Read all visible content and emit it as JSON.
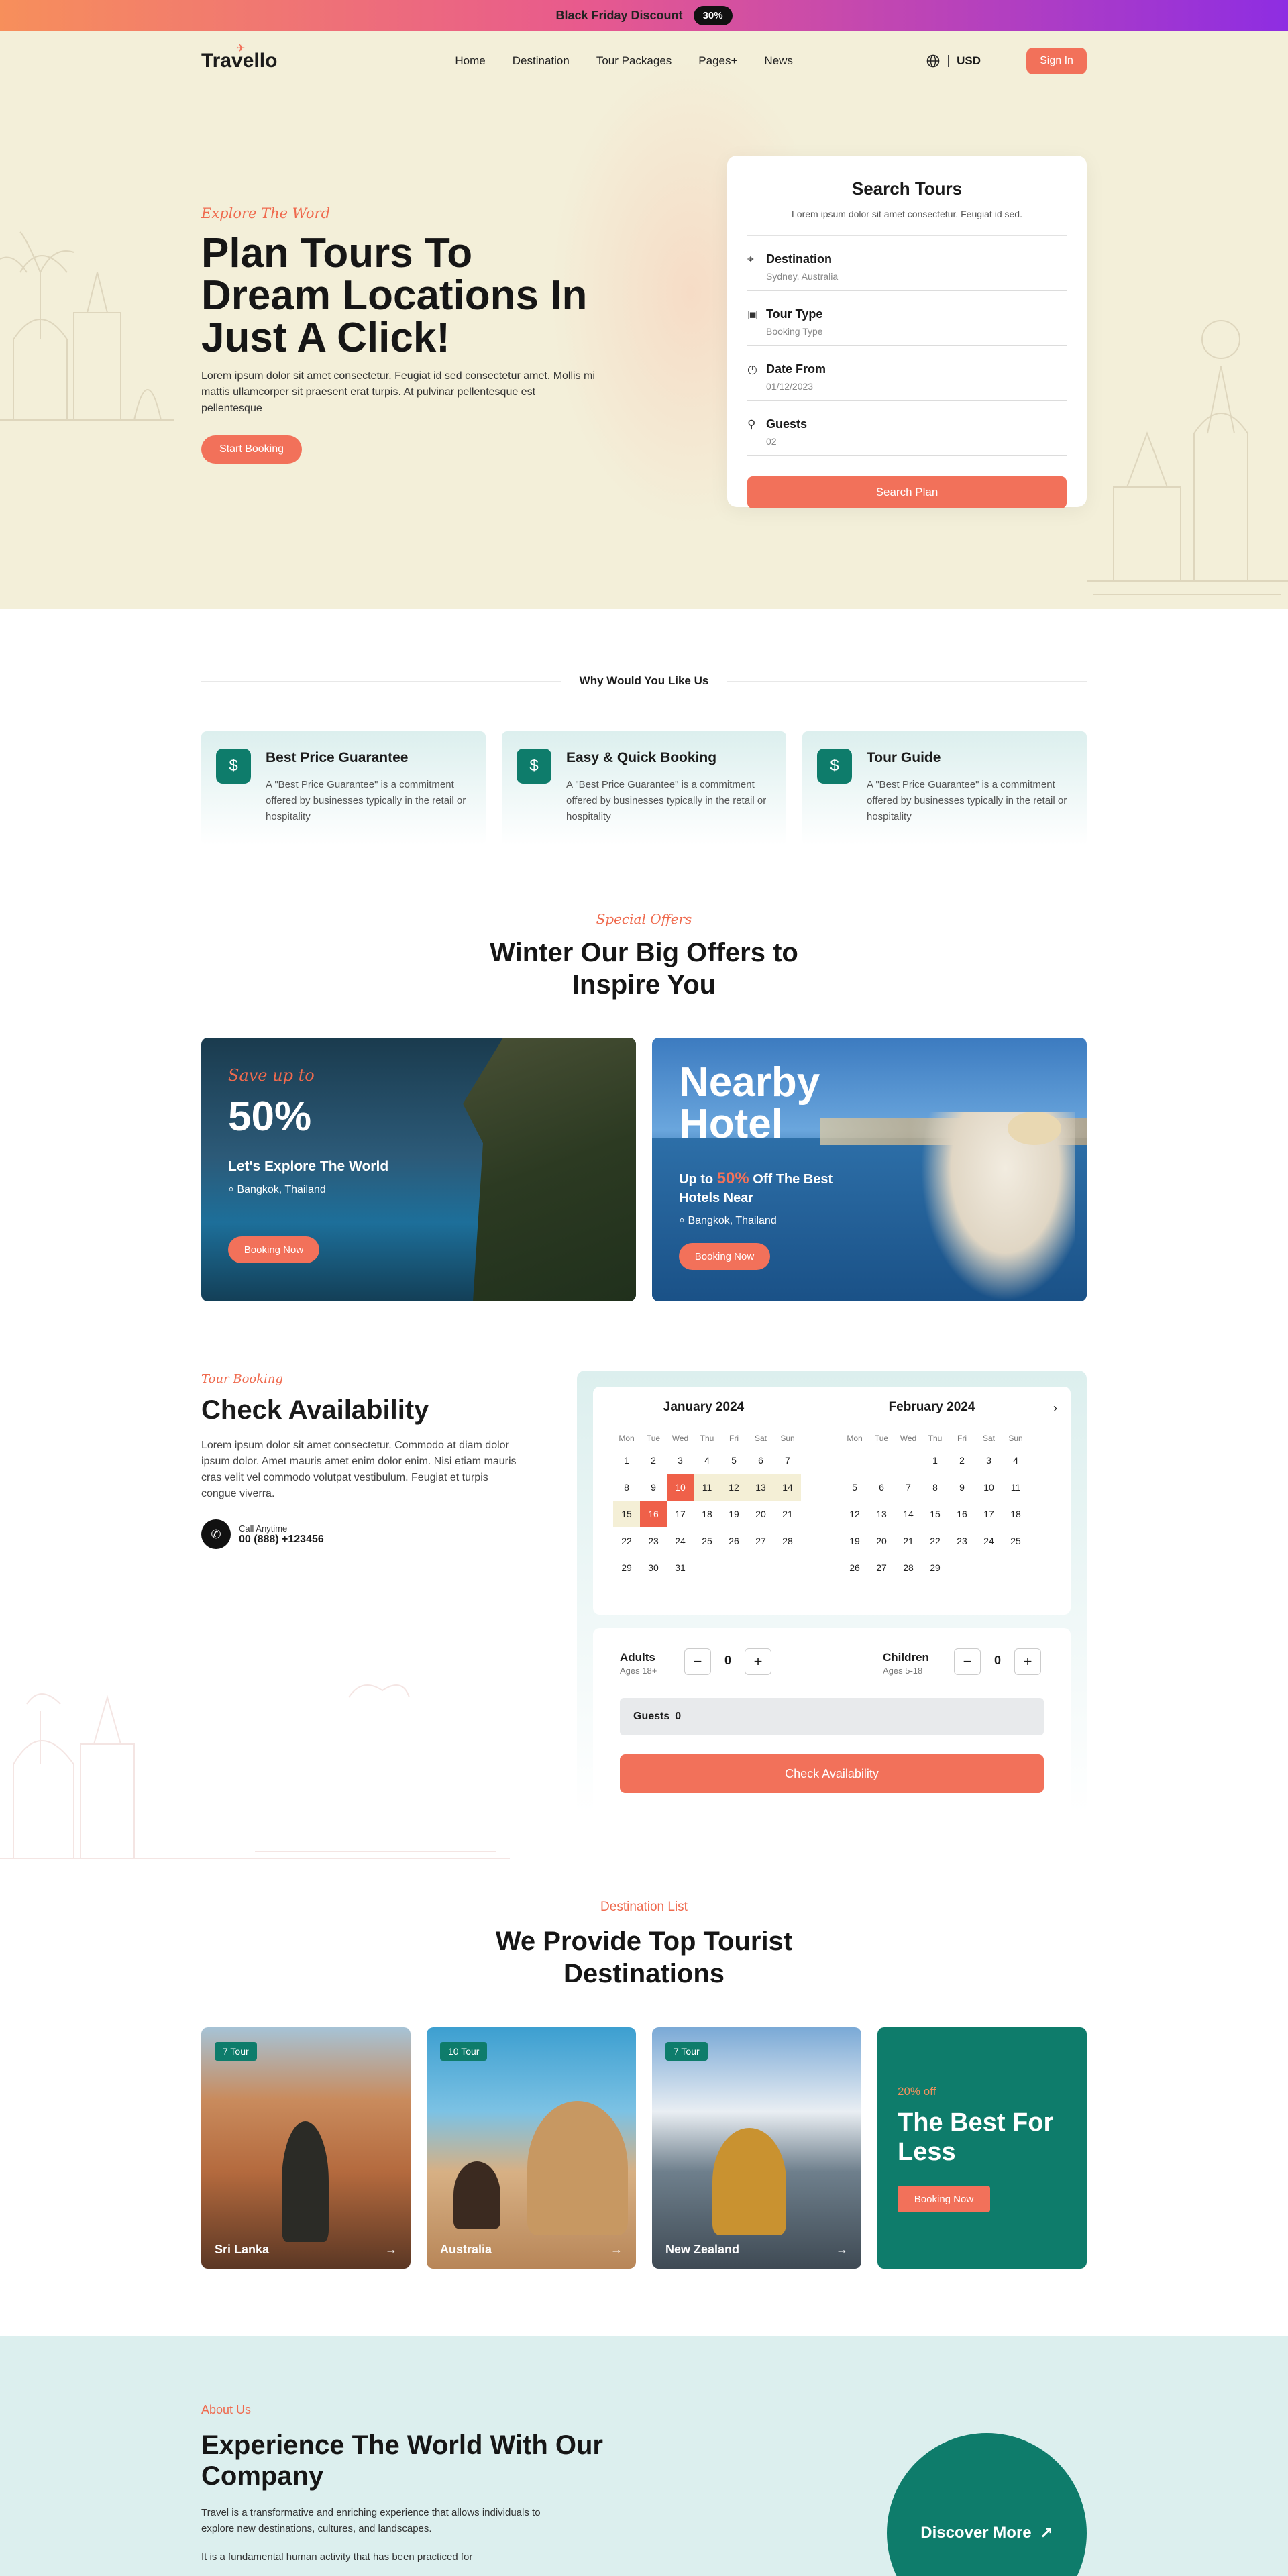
{
  "promo": {
    "text": "Black Friday Discount",
    "badge": "30%"
  },
  "nav": {
    "logo": "Travello",
    "items": [
      "Home",
      "Destination",
      "Tour Packages",
      "Pages+",
      "News"
    ],
    "currency": "USD",
    "signin": "Sign In"
  },
  "hero": {
    "script": "Explore The Word",
    "title": "Plan Tours To Dream Locations In Just A Click!",
    "desc": "Lorem ipsum dolor sit amet consectetur. Feugiat id sed consectetur amet. Mollis mi mattis ullamcorper sit praesent erat turpis. At pulvinar pellentesque est pellentesque",
    "cta": "Start Booking"
  },
  "search": {
    "title": "Search Tours",
    "subtitle": "Lorem ipsum dolor sit amet consectetur. Feugiat id sed.",
    "fields": [
      {
        "label": "Destination",
        "value": "Sydney, Australia",
        "icon": "location-pin-icon"
      },
      {
        "label": "Tour Type",
        "value": "Booking Type",
        "icon": "bag-icon"
      },
      {
        "label": "Date From",
        "value": "01/12/2023",
        "icon": "clock-icon"
      },
      {
        "label": "Guests",
        "value": "02",
        "icon": "user-icon"
      }
    ],
    "button": "Search Plan"
  },
  "why": {
    "heading": "Why Would You Like Us",
    "cards": [
      {
        "title": "Best Price Guarantee",
        "desc": "A \"Best Price Guarantee\" is a commitment offered by businesses typically in the retail or hospitality"
      },
      {
        "title": "Easy & Quick Booking",
        "desc": "A \"Best Price Guarantee\" is a commitment offered by businesses typically in the retail or hospitality"
      },
      {
        "title": "Tour Guide",
        "desc": "A \"Best Price Guarantee\" is a commitment offered by businesses typically in the retail or hospitality"
      }
    ]
  },
  "offers": {
    "script": "Special Offers",
    "title": "Winter Our Big Offers to Inspire You",
    "offer1": {
      "script": "Save up to",
      "big": "50%",
      "heading": "Let's Explore The World",
      "location": "Bangkok, Thailand",
      "button": "Booking Now"
    },
    "offer2": {
      "big": "Nearby Hotel",
      "h_pre": "Up to ",
      "h_pct": "50%",
      "h_post": " Off The Best Hotels Near",
      "location": "Bangkok, Thailand",
      "button": "Booking Now"
    }
  },
  "availability": {
    "script": "Tour Booking",
    "title": "Check Availability",
    "desc": "Lorem ipsum dolor sit amet consectetur. Commodo at diam dolor ipsum dolor. Amet mauris amet enim dolor enim. Nisi etiam mauris cras velit vel commodo volutpat vestibulum. Feugiat et turpis congue viverra.",
    "call_label": "Call Anytime",
    "call_number": "00 (888) +123456",
    "calendar": {
      "day_headers": [
        "Mon",
        "Tue",
        "Wed",
        "Thu",
        "Fri",
        "Sat",
        "Sun"
      ],
      "months": [
        {
          "name": "January 2024",
          "lead": 0,
          "days": 31,
          "selected": [
            10,
            16
          ],
          "range": [
            11,
            12,
            13,
            14,
            15
          ]
        },
        {
          "name": "February 2024",
          "lead": 3,
          "days": 29,
          "selected": [],
          "range": []
        }
      ]
    },
    "adults": {
      "label": "Adults",
      "sub": "Ages 18+",
      "value": "0"
    },
    "children": {
      "label": "Children",
      "sub": "Ages 5-18",
      "value": "0"
    },
    "guests_label": "Guests",
    "guests_value": "0",
    "button": "Check Availability"
  },
  "destinations": {
    "label": "Destination List",
    "title": "We Provide Top Tourist Destinations",
    "cards": [
      {
        "tag": "7 Tour",
        "name": "Sri Lanka"
      },
      {
        "tag": "10 Tour",
        "name": "Australia"
      },
      {
        "tag": "7 Tour",
        "name": "New Zealand"
      }
    ],
    "promo": {
      "pct": "20% off",
      "title": "The Best For Less",
      "button": "Booking Now"
    }
  },
  "about": {
    "label": "About Us",
    "title": "Experience The World With Our Company",
    "p1": "Travel is a transformative and enriching experience that allows individuals to explore new destinations, cultures, and landscapes.",
    "p2": "It is a fundamental human activity that has been practiced for",
    "discover": "Discover More"
  },
  "colors": {
    "accent": "#f2715a",
    "teal": "#0e7c6b",
    "hero_bg": "#f3efd9",
    "soft_teal": "#dcefee"
  }
}
